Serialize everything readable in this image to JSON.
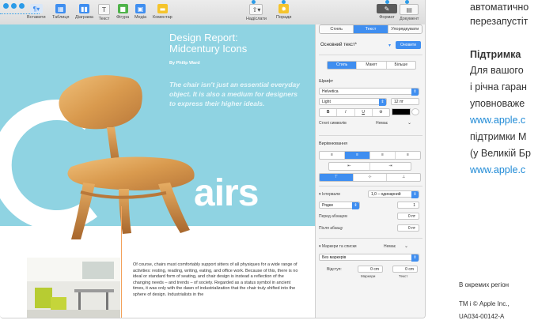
{
  "toolbar": {
    "buttons": [
      {
        "label": "Вставити",
        "icon": "insert-icon"
      },
      {
        "label": "Таблиця",
        "icon": "table-icon"
      },
      {
        "label": "Діаграма",
        "icon": "chart-icon"
      },
      {
        "label": "Текст",
        "icon": "text-icon"
      },
      {
        "label": "Фігура",
        "icon": "shape-icon"
      },
      {
        "label": "Медіа",
        "icon": "media-icon"
      },
      {
        "label": "Коментар",
        "icon": "comment-icon"
      }
    ],
    "share_label": "Надіслати",
    "tips_label": "Поради",
    "format_label": "Формат",
    "document_label": "Документ"
  },
  "page": {
    "title": "Design Report: Midcentury Icons",
    "byline": "By Philip Ward",
    "quote": "The chair isn't just an essential everyday object. It is also a medium for designers to express their higher ideals.",
    "big_word": "airs",
    "body": "Of course, chairs must comfortably support sitters of all physiques for a wide range of activities: resting, reading, writing, eating, and office work. Because of this, there is no ideal or standard form of seating, and chair design is instead a reflection of the changing needs – and trends – of society. Regarded as a status symbol in ancient times, it was only with the dawn of industrialization that the chair truly shifted into the sphere of design. Industrialists in the"
  },
  "inspector": {
    "tabs": [
      "Стиль",
      "Текст",
      "Упорядкувати"
    ],
    "active_tab": "Текст",
    "paragraph_style": "Основний текст*",
    "update_button": "Оновити",
    "subtabs": [
      "Стиль",
      "Макет",
      "Більше"
    ],
    "font_section": "Шрифт",
    "font_family": "Helvetica",
    "font_weight": "Light",
    "font_size": "12 пт",
    "style_buttons": [
      "B",
      "I",
      "U",
      "⚙"
    ],
    "char_styles_label": "Стилі символів",
    "char_styles_value": "Немає",
    "alignment_section": "Вирівнювання",
    "spacing_label": "Інтервали",
    "spacing_value": "1,0 – одинарний",
    "lines_label": "Рядки",
    "lines_value": "1",
    "before_label": "Перед абзацом",
    "before_value": "0 пт",
    "after_label": "Після абзацу",
    "after_value": "0 пт",
    "bullets_label": "Маркери та списки",
    "bullets_value": "Немає",
    "no_bullets": "Без маркерів",
    "indent_label": "Відступ:",
    "indent_bullet": "0 cm",
    "indent_text": "0 cm",
    "indent_bullet_caption": "Маркери",
    "indent_text_caption": "Текст"
  },
  "doc_text": {
    "line1": "автоматично",
    "line2": "перезапустіт",
    "support_heading": "Підтримка",
    "l3": "Для вашого",
    "l4": "і річна гаран",
    "l5": "уповноваже",
    "link1": "www.apple.c",
    "l6": "підтримки М",
    "l7": "(у Великій Бр",
    "link2": "www.apple.c",
    "region": "В окремих регіон",
    "copyright": "TM і © Apple Inc.,",
    "code": "UA034-00142-A"
  },
  "colors": {
    "accent": "#3f8ef0",
    "page_bg": "#8fd3e2",
    "link": "#1f8ad6"
  }
}
